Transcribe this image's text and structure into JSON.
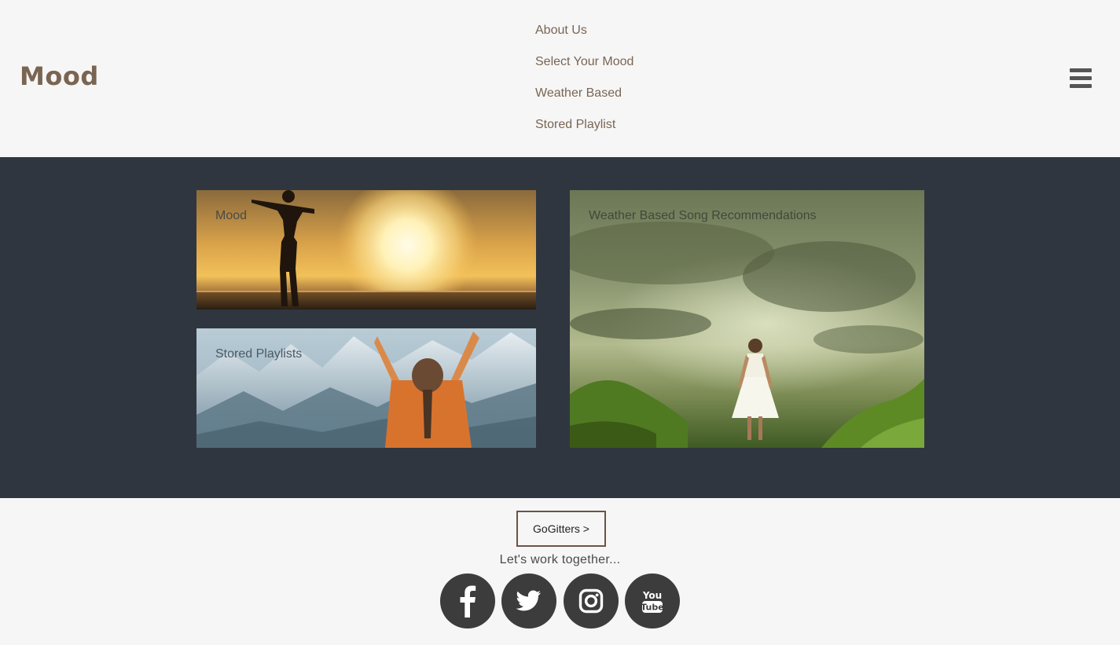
{
  "header": {
    "logo": "Mood",
    "nav": [
      "About Us",
      "Select Your Mood",
      "Weather Based",
      "Stored Playlist"
    ],
    "menu_icon": "hamburger-menu-icon"
  },
  "cards": {
    "mood": {
      "label": "Mood",
      "image": "woman-silhouette-sunset"
    },
    "stored": {
      "label": "Stored Playlists",
      "image": "person-arms-raised-mountains"
    },
    "weather": {
      "label": "Weather Based Song Recommendations",
      "image": "girl-in-white-dress-stormy-sky"
    }
  },
  "footer": {
    "cta_label": "GoGitters >",
    "tagline": "Let's work together...",
    "social_icons": [
      "facebook-icon",
      "twitter-icon",
      "instagram-icon",
      "youtube-icon"
    ]
  },
  "colors": {
    "brand": "#7a6552",
    "dark_band": "#303640",
    "background": "#f6f6f6",
    "social_circle": "#3c3c3c"
  }
}
